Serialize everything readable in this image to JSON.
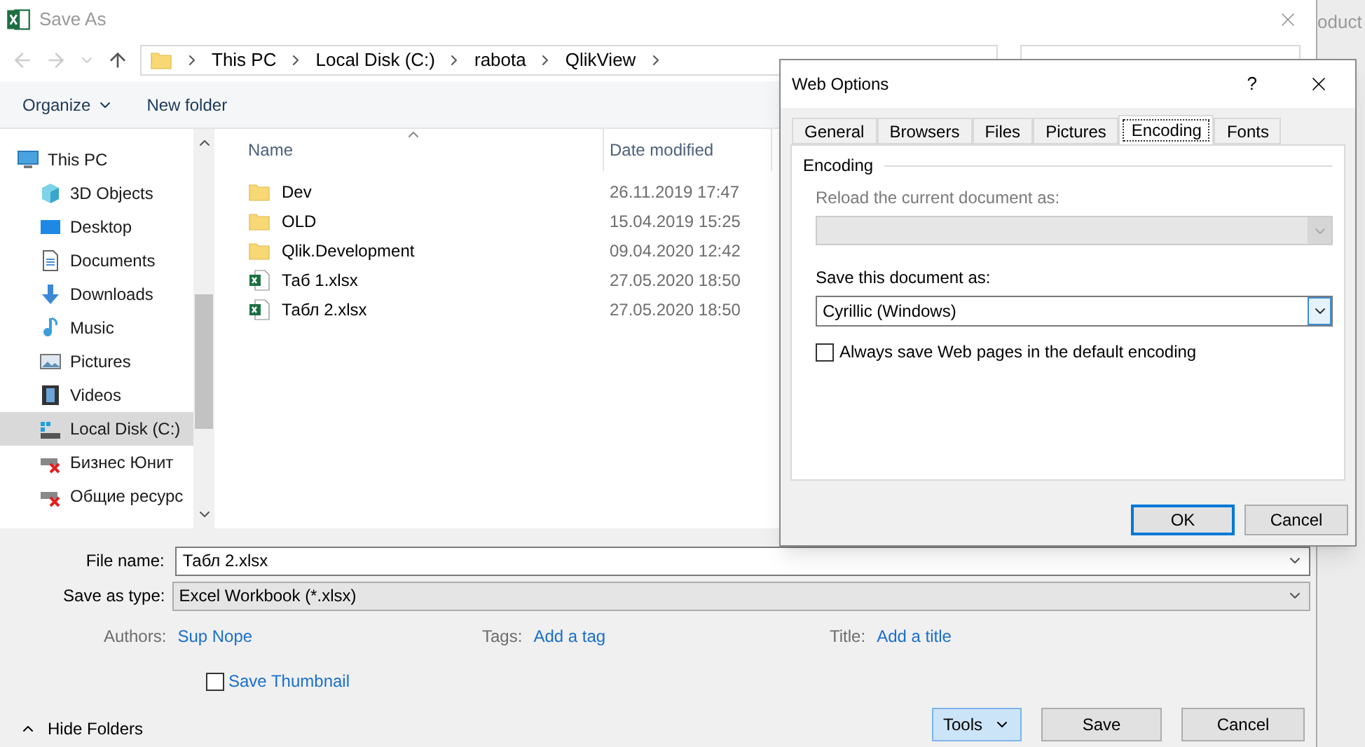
{
  "window": {
    "title": "Save As"
  },
  "background_text": "oduct",
  "address": {
    "crumbs": [
      "This PC",
      "Local Disk (C:)",
      "rabota",
      "QlikView"
    ]
  },
  "toolbar": {
    "organize": "Organize",
    "new_folder": "New folder"
  },
  "sidebar": {
    "items": [
      {
        "label": "This PC",
        "kind": "pc",
        "selected": false,
        "children": [
          {
            "label": "3D Objects",
            "kind": "cube",
            "selected": false
          },
          {
            "label": "Desktop",
            "kind": "desktop",
            "selected": false
          },
          {
            "label": "Documents",
            "kind": "documents",
            "selected": false
          },
          {
            "label": "Downloads",
            "kind": "downloads",
            "selected": false
          },
          {
            "label": "Music",
            "kind": "music",
            "selected": false
          },
          {
            "label": "Pictures",
            "kind": "pictures",
            "selected": false
          },
          {
            "label": "Videos",
            "kind": "videos",
            "selected": false
          },
          {
            "label": "Local Disk (C:)",
            "kind": "disk",
            "selected": true
          },
          {
            "label": "Бизнес Юнит",
            "kind": "netdrive",
            "selected": false
          },
          {
            "label": "Общие ресурс",
            "kind": "netdrive",
            "selected": false
          }
        ]
      }
    ]
  },
  "file_list": {
    "columns": [
      "Name",
      "Date modified"
    ],
    "rows": [
      {
        "kind": "folder",
        "name": "Dev",
        "date": "26.11.2019 17:47"
      },
      {
        "kind": "folder",
        "name": "OLD",
        "date": "15.04.2019 15:25"
      },
      {
        "kind": "folder",
        "name": "Qlik.Development",
        "date": "09.04.2020 12:42"
      },
      {
        "kind": "excel",
        "name": "Таб 1.xlsx",
        "date": "27.05.2020 18:50"
      },
      {
        "kind": "excel",
        "name": "Табл 2.xlsx",
        "date": "27.05.2020 18:50"
      }
    ]
  },
  "form": {
    "file_name": {
      "label": "File name:",
      "value": "Табл 2.xlsx"
    },
    "save_as_type": {
      "label": "Save as type:",
      "value": "Excel Workbook (*.xlsx)"
    },
    "meta": [
      {
        "label": "Authors:",
        "value": "Sup Nope"
      },
      {
        "label": "Tags:",
        "value": "Add a tag"
      },
      {
        "label": "Title:",
        "value": "Add a title"
      }
    ],
    "save_thumbnail": {
      "label": "Save Thumbnail",
      "checked": false
    }
  },
  "hide_folders": "Hide Folders",
  "buttons": {
    "tools": "Tools",
    "save": "Save",
    "cancel": "Cancel"
  },
  "dialog": {
    "title": "Web Options",
    "help": "?",
    "tabs": [
      {
        "label": "General",
        "selected": false
      },
      {
        "label": "Browsers",
        "selected": false
      },
      {
        "label": "Files",
        "selected": false
      },
      {
        "label": "Pictures",
        "selected": false
      },
      {
        "label": "Encoding",
        "selected": true
      },
      {
        "label": "Fonts",
        "selected": false
      }
    ],
    "group": "Encoding",
    "reload": {
      "label": "Reload the current document as:",
      "disabled": true
    },
    "save_as": {
      "label": "Save this document as:",
      "value": "Cyrillic (Windows)"
    },
    "checkbox": {
      "label": "Always save Web pages in the default encoding",
      "checked": false
    },
    "ok": "OK",
    "cancel": "Cancel"
  }
}
